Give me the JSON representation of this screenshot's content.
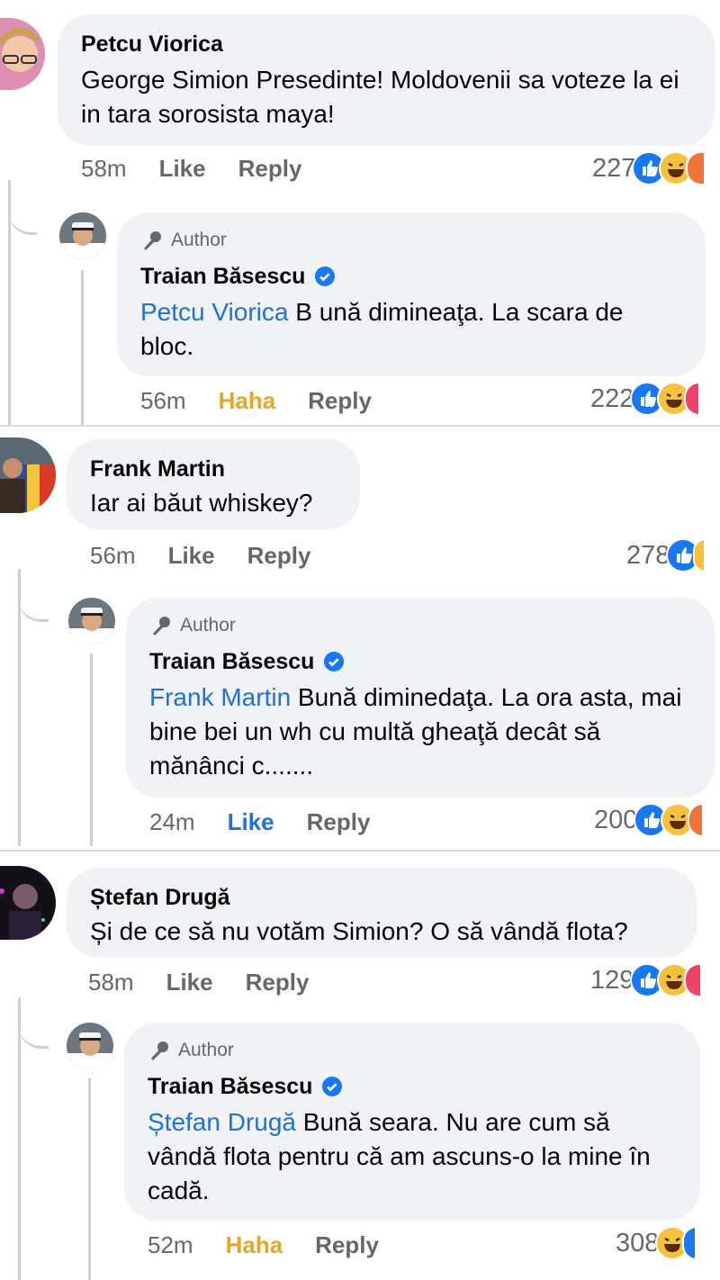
{
  "threads": [
    {
      "comment": {
        "name": "Petcu Viorica",
        "text": "George Simion Presedinte! Moldovenii sa voteze la ei in tara sorosista maya!",
        "time": "58m",
        "action": "Like",
        "reply": "Reply",
        "count": "227",
        "reactions": [
          "like-icon",
          "haha-icon",
          "angry-icon"
        ]
      },
      "reply": {
        "badge": "Author",
        "name": "Traian Băsescu",
        "verified": true,
        "mention": "Petcu Viorica",
        "text": " B ună dimineaţa. La scara de bloc.",
        "time": "56m",
        "action": "Haha",
        "reply": "Reply",
        "count": "222",
        "reactions": [
          "like-icon",
          "haha-icon",
          "love-icon"
        ]
      }
    },
    {
      "comment": {
        "name": "Frank Martin",
        "text": "Iar ai băut whiskey?",
        "time": "56m",
        "action": "Like",
        "reply": "Reply",
        "count": "278",
        "reactions": [
          "like-icon",
          "haha-icon"
        ]
      },
      "reply": {
        "badge": "Author",
        "name": "Traian Băsescu",
        "verified": true,
        "mention": "Frank Martin",
        "text": " Bună diminedaţa. La ora asta, mai bine bei un wh cu multă gheaţă decât să mănânci c.......",
        "time": "24m",
        "action": "Like",
        "reply": "Reply",
        "count": "200",
        "reactions": [
          "like-icon",
          "haha-icon",
          "angry-icon"
        ]
      }
    },
    {
      "comment": {
        "name": "Ștefan Drugă",
        "text": "Și de ce să nu votăm Simion? O să vândă flota?",
        "time": "58m",
        "action": "Like",
        "reply": "Reply",
        "count": "129",
        "reactions": [
          "like-icon",
          "haha-icon",
          "love-icon"
        ]
      },
      "reply": {
        "badge": "Author",
        "name": "Traian Băsescu",
        "verified": true,
        "mention": "Ștefan Drugă",
        "text": " Bună seara. Nu are cum să vândă flota pentru că am ascuns-o la mine în cadă.",
        "time": "52m",
        "action": "Haha",
        "reply": "Reply",
        "count": "308",
        "reactions": [
          "haha-icon",
          "like-icon"
        ]
      }
    }
  ],
  "colors": {
    "accent": "#216fdb",
    "haha": "#e4a626",
    "bubble": "#f0f2f5",
    "muted": "#65676b"
  }
}
